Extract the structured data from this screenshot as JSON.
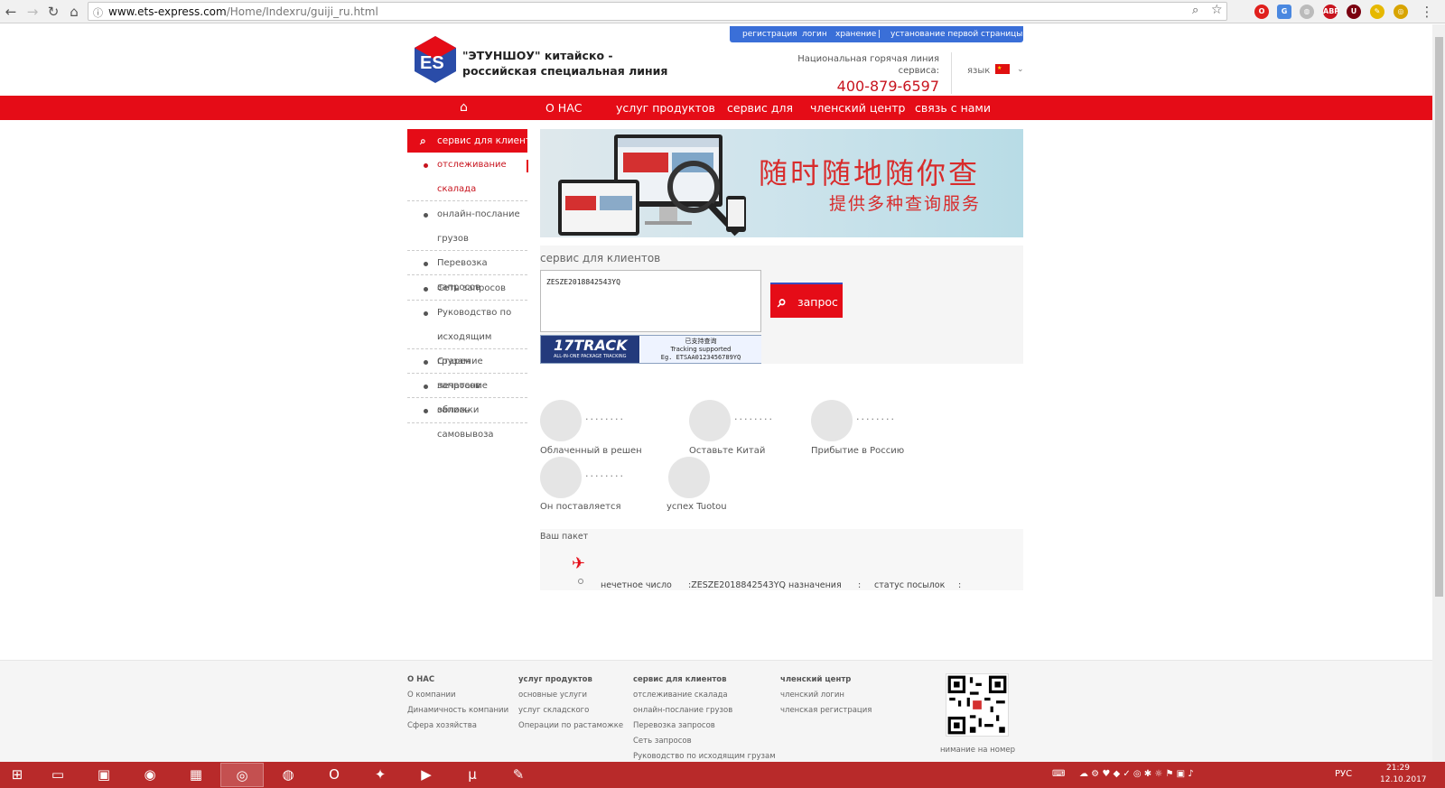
{
  "browser": {
    "url_host": "www.ets-express.com",
    "url_path": "/Home/Indexru/guiji_ru.html"
  },
  "header": {
    "toplinks": [
      "регистрация",
      "логин",
      "хранение",
      "|",
      "установание первой страницы"
    ],
    "brand_line1": "\"ЭТУНШОУ\"  китайско -",
    "brand_line2": "российская специальная  линия",
    "hotline_line1": "Национальная горячая линия",
    "hotline_line2": "сервиса:",
    "phone": "400-879-6597",
    "lang_label": "язык"
  },
  "nav": [
    "О НАС",
    "услуг продуктов",
    "сервис для",
    "членский центр",
    "связь с нами"
  ],
  "sidebar": {
    "title": "сервис для клиентов",
    "items": [
      {
        "line1": "отслеживание",
        "line2": "скалада"
      },
      {
        "line1": "онлайн-послание",
        "line2": "грузов"
      },
      {
        "line1": "Перевозка запросов",
        "line2": ""
      },
      {
        "line1": "Сеть запросов",
        "line2": ""
      },
      {
        "line1": "Руководство по",
        "line2": "исходящим грузам"
      },
      {
        "line1": "Старение запросов",
        "line2": ""
      },
      {
        "line1": "печатание обложки",
        "line2": ""
      },
      {
        "line1": "запись самовывоза",
        "line2": ""
      }
    ]
  },
  "banner": {
    "title": "随时随地随你查",
    "subtitle": "提供多种查询服务"
  },
  "query": {
    "title": "сервис для клиентов",
    "tracking_value": "ZESZE2018842543YQ",
    "button_label": "запрос",
    "track_logo": "17TRACK",
    "track_tagline": "ALL-IN-ONE PACKAGE TRACKING",
    "track_cn": "已支持查询",
    "track_supported": "Tracking supported",
    "track_example": "Eg. ETSAA0123456789YQ"
  },
  "steps": [
    {
      "label": "Облаченный в решен"
    },
    {
      "label": "Оставьте Китай"
    },
    {
      "label": "Прибытие в Россию"
    },
    {
      "label": "Он поставляется"
    },
    {
      "label": "успех Tuotou"
    }
  ],
  "package": {
    "title": "Ваш пакет",
    "odd_number_label": "нечетное число",
    "odd_number_value": ":ZESZE2018842543YQ",
    "destination_label": "назначения",
    "destination_value": ":",
    "status_label": "статус посылок",
    "status_value": ":"
  },
  "footer": {
    "columns": [
      {
        "heading": "О НАС",
        "links": [
          "О компании",
          "Динамичность компании",
          "Сфера хозяйства"
        ]
      },
      {
        "heading": "услуг продуктов",
        "links": [
          "основные услуги",
          "услуг складского",
          "Операции по растаможке"
        ]
      },
      {
        "heading": "сервис для клиентов",
        "links": [
          "отслеживание скалада",
          "онлайн-послание грузов",
          "Перевозка запросов",
          "Сеть запросов",
          "Руководство по исходящим грузам"
        ]
      },
      {
        "heading": "членский центр",
        "links": [
          "членский логин",
          "членская регистрация"
        ]
      }
    ],
    "qr_caption": "нимание на номер"
  },
  "taskbar": {
    "lang": "РУС",
    "time": "21:29",
    "date": "12.10.2017"
  },
  "colors": {
    "brand_red": "#e50c17",
    "taskbar": "#b82a2a",
    "toplinks_blue": "#3a6fd8"
  }
}
